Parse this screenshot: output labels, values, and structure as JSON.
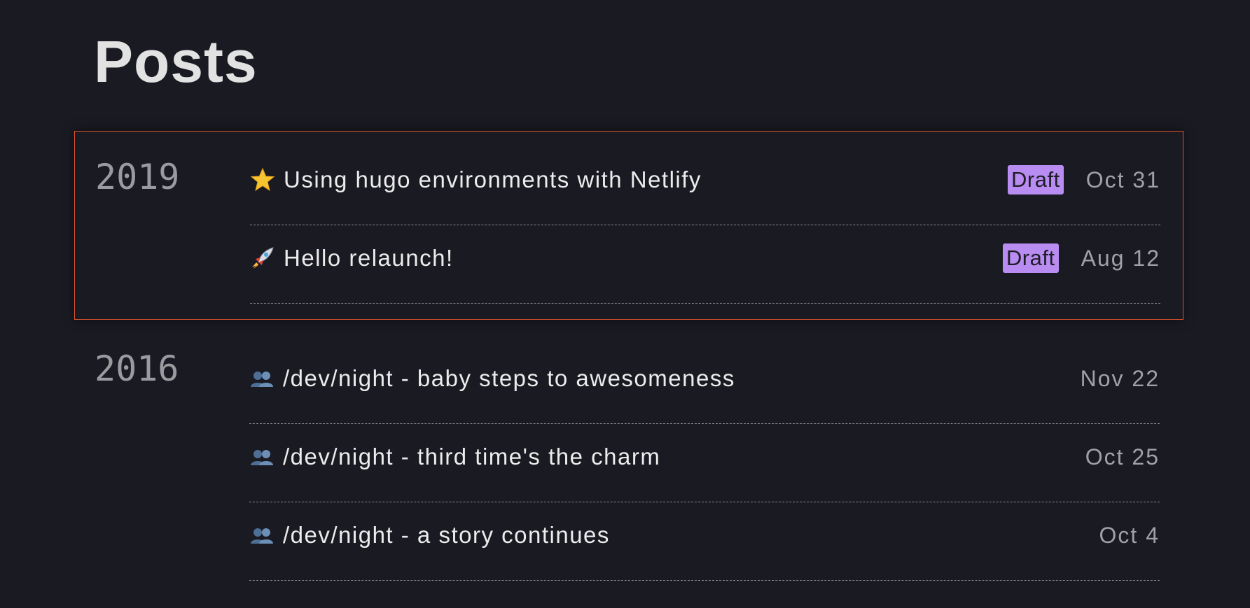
{
  "page": {
    "title": "Posts"
  },
  "groups": [
    {
      "year": "2019",
      "posts": [
        {
          "icon": "star-icon",
          "title": "Using hugo environments with Netlify",
          "badge": "Draft",
          "date": "Oct 31"
        },
        {
          "icon": "rocket-icon",
          "title": "Hello relaunch!",
          "badge": "Draft",
          "date": "Aug 12"
        }
      ]
    },
    {
      "year": "2016",
      "posts": [
        {
          "icon": "people-icon",
          "title": "/dev/night - baby steps to awesomeness",
          "date": "Nov 22"
        },
        {
          "icon": "people-icon",
          "title": "/dev/night - third time's the charm",
          "date": "Oct 25"
        },
        {
          "icon": "people-icon",
          "title": "/dev/night - a story continues",
          "date": "Oct 4"
        }
      ]
    }
  ],
  "colors": {
    "background": "#1a1a23",
    "highlight_border": "#e0552e",
    "draft_badge": "#b98cf2"
  }
}
